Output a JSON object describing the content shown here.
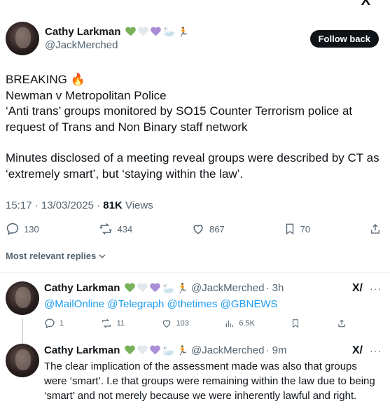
{
  "top_right_glyph": "X",
  "post": {
    "author_name": "Cathy Larkman",
    "author_handle": "@JackMerched",
    "follow_label": "Follow back",
    "emoji": [
      "green-heart",
      "white-heart",
      "purple-heart",
      "swan",
      "suffragette-figure"
    ],
    "line1_text": "BREAKING",
    "line2": "Newman v Metropolitan Police",
    "line3": "‘Anti trans’ groups monitored by SO15 Counter Terrorism police at request of Trans and Non Binary staff network",
    "line4": "Minutes disclosed of a meeting reveal groups were described by CT as ‘extremely smart’, but ‘staying within the law’.",
    "time": "15:17 · 13/03/2025 · ",
    "views_count": "81K",
    "views_label": " Views",
    "replies": "130",
    "reposts": "434",
    "likes": "867",
    "bookmarks": "70"
  },
  "sort_label": "Most relevant replies",
  "replies": [
    {
      "author_name": "Cathy Larkman",
      "handle": "@JackMerched",
      "time": "· 3h",
      "mentions": "@MailOnline @Telegraph @thetimes @GBNEWS",
      "reply_count": "1",
      "repost_count": "11",
      "like_count": "103",
      "view_count": "6.5K"
    },
    {
      "author_name": "Cathy Larkman",
      "handle": "@JackMerched",
      "time": "· 9m",
      "text": "The clear implication of the assessment made was also that groups were ‘smart’. I.e that groups were remaining within the law due to being ‘smart’ and not merely because we were inherently lawful and right."
    }
  ],
  "colors": {
    "text": "#0f1419",
    "secondary": "#536471",
    "link": "#1d9bf0",
    "green_heart": "#78b159",
    "white_heart": "#e1e8ed",
    "purple_heart": "#aa8ed6"
  }
}
